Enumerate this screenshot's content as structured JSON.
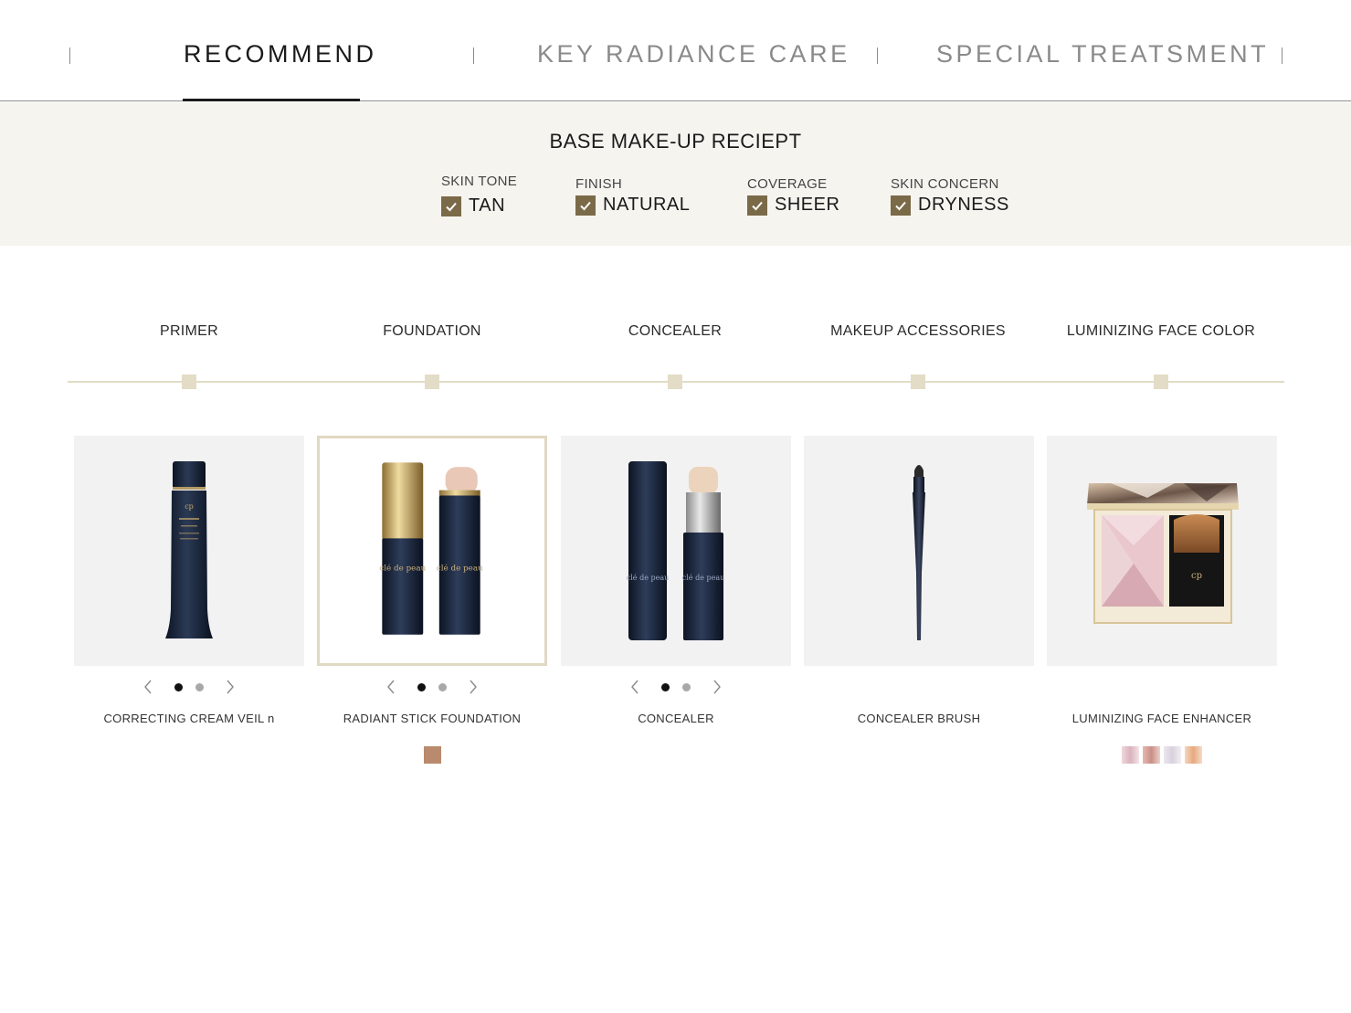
{
  "tabs": [
    {
      "label": "RECOMMEND",
      "active": true
    },
    {
      "label": "KEY RADIANCE CARE",
      "active": false
    },
    {
      "label": "SPECIAL TREATSMENT",
      "active": false
    }
  ],
  "receipt": {
    "title": "BASE MAKE-UP RECIEPT",
    "filters": [
      {
        "label": "SKIN TONE",
        "value": "TAN",
        "checked": true
      },
      {
        "label": "FINISH",
        "value": "NATURAL",
        "checked": true
      },
      {
        "label": "COVERAGE",
        "value": "SHEER",
        "checked": true
      },
      {
        "label": "SKIN CONCERN",
        "value": "DRYNESS",
        "checked": true
      }
    ]
  },
  "categories": [
    "PRIMER",
    "FOUNDATION",
    "CONCEALER",
    "MAKEUP ACCESSORIES",
    "LUMINIZING FACE COLOR"
  ],
  "products": [
    {
      "name": "CORRECTING CREAM VEIL n",
      "image": "primer-tube",
      "has_pager": true,
      "pager_count": 2,
      "pager_active": 0,
      "swatches": []
    },
    {
      "name": "RADIANT STICK FOUNDATION",
      "image": "foundation-stick",
      "has_pager": true,
      "pager_count": 2,
      "pager_active": 0,
      "selected": true,
      "swatches": [
        "#b98a6d"
      ]
    },
    {
      "name": "CONCEALER",
      "image": "concealer-stick",
      "has_pager": true,
      "pager_count": 2,
      "pager_active": 0,
      "swatches": []
    },
    {
      "name": "CONCEALER BRUSH",
      "image": "concealer-brush",
      "has_pager": false,
      "swatches": []
    },
    {
      "name": "LUMINIZING FACE ENHANCER",
      "image": "face-enhancer-compact",
      "has_pager": false,
      "swatches": [
        "#e8c9cf",
        "#d9a9a2",
        "#e9e2ea",
        "#f0c4a4"
      ]
    }
  ],
  "colors": {
    "accent_gold": "#7a6a48",
    "timeline": "#e3dcc6",
    "receipt_bg": "#f6f4ef",
    "card_bg": "#f2f2f2"
  }
}
